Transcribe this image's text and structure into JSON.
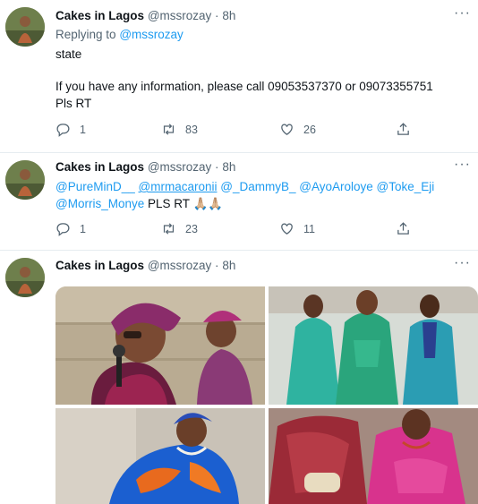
{
  "tweets": [
    {
      "name": "Cakes in Lagos",
      "handle": "@mssrozay",
      "sep": "·",
      "time": "8h",
      "replying_prefix": "Replying to",
      "replying_handle": "@mssrozay",
      "line1": "state",
      "line2": "If you have any information, please call 09053537370 or 09073355751",
      "line3": "Pls RT",
      "reply_count": "1",
      "retweet_count": "83",
      "like_count": "26"
    },
    {
      "name": "Cakes in Lagos",
      "handle": "@mssrozay",
      "sep": "·",
      "time": "8h",
      "mentions1": [
        "@PureMinD__",
        "@mrmacaronii",
        "@_DammyB_",
        "@AyoAroloye",
        "@Toke_Eji"
      ],
      "mention2": "@Morris_Monye",
      "tail": "PLS RT 🙏🏼🙏🏼",
      "reply_count": "1",
      "retweet_count": "23",
      "like_count": "11"
    },
    {
      "name": "Cakes in Lagos",
      "handle": "@mssrozay",
      "sep": "·",
      "time": "8h"
    }
  ],
  "more_glyph": "···",
  "icons": [
    "reply-icon",
    "retweet-icon",
    "like-icon",
    "share-icon",
    "more-icon"
  ]
}
